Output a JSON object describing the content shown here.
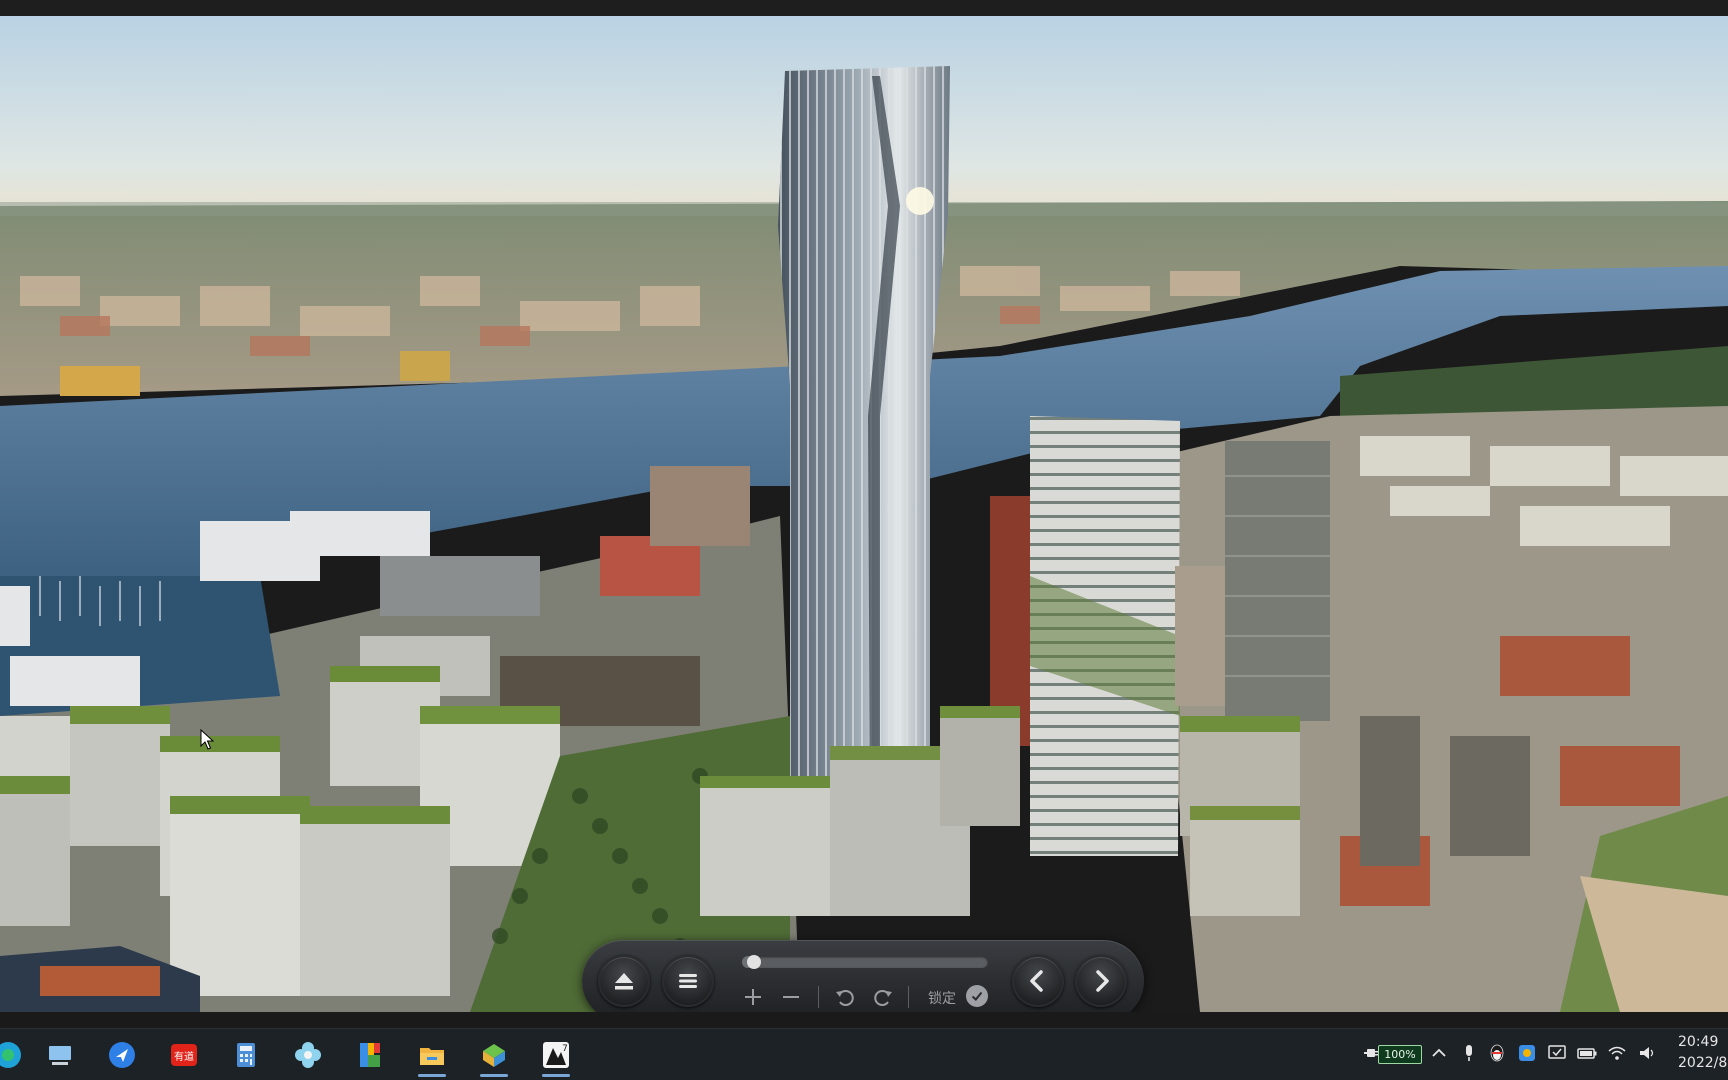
{
  "viewer": {
    "image_description_icon": "city-skyline-photo",
    "toolbar": {
      "progress_fraction": 0.02,
      "lock_label": "锁定",
      "icons": [
        "eject-icon",
        "menu-icon",
        "zoom-in-icon",
        "zoom-out-icon",
        "rotate-left-icon",
        "rotate-right-icon",
        "check-icon",
        "prev-icon",
        "next-icon"
      ]
    }
  },
  "taskbar": {
    "apps": [
      {
        "name": "browser-icon",
        "active": false
      },
      {
        "name": "computer-icon",
        "active": false
      },
      {
        "name": "feishu-icon",
        "active": false
      },
      {
        "name": "youdao-icon",
        "label": "有道",
        "active": false
      },
      {
        "name": "calculator-icon",
        "active": false
      },
      {
        "name": "flower-app-icon",
        "active": false
      },
      {
        "name": "palette-app-icon",
        "active": false
      },
      {
        "name": "file-explorer-icon",
        "active": true
      },
      {
        "name": "cube-app-icon",
        "active": true
      },
      {
        "name": "image-viewer-icon",
        "badge": "7",
        "active": true
      }
    ],
    "tray": {
      "battery_percent": "100%",
      "time": "20:49",
      "date": "2022/8",
      "icons": [
        "plug-icon",
        "chevron-up-icon",
        "microphone-icon",
        "penguin-icon",
        "color-app-icon",
        "security-icon",
        "battery-icon",
        "wifi-icon",
        "speaker-icon"
      ]
    }
  },
  "colors": {
    "taskbar_bg": "#1d2227",
    "toolbar_bg": "#2b2e32",
    "battery_green": "#9fd8a4"
  }
}
